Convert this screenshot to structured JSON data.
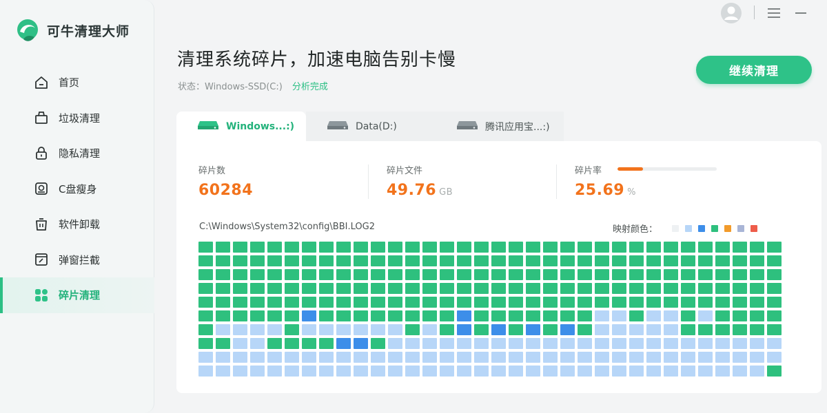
{
  "app": {
    "name": "可牛清理大师"
  },
  "sidebar": {
    "items": [
      {
        "label": "首页",
        "icon": "home-icon"
      },
      {
        "label": "垃圾清理",
        "icon": "trash-cart-icon"
      },
      {
        "label": "隐私清理",
        "icon": "lock-icon"
      },
      {
        "label": "C盘瘦身",
        "icon": "disk-icon"
      },
      {
        "label": "软件卸载",
        "icon": "uninstall-icon"
      },
      {
        "label": "弹窗拦截",
        "icon": "popup-block-icon"
      },
      {
        "label": "碎片清理",
        "icon": "fragment-grid-icon",
        "active": true
      }
    ]
  },
  "header": {
    "title": "清理系统碎片，加速电脑告别卡慢",
    "status_prefix": "状态：Windows-SSD(C:)",
    "status_value": "分析完成",
    "continue_label": "继续清理"
  },
  "window_controls": {
    "avatar": "user-avatar-icon",
    "menu": "menu-icon",
    "minimize": "minimize-icon"
  },
  "tabs": [
    {
      "label": "Windows...:)",
      "active": true
    },
    {
      "label": "Data(D:)",
      "active": false
    },
    {
      "label": "腾讯应用宝...:)",
      "active": false
    }
  ],
  "stats": {
    "fragments": {
      "label": "碎片数",
      "value": "60284"
    },
    "files": {
      "label": "碎片文件",
      "value": "49.76",
      "unit": "GB"
    },
    "rate": {
      "label": "碎片率",
      "value": "25.69",
      "unit": "%",
      "fraction": 0.2569
    }
  },
  "current_path": "C:\\Windows\\System32\\config\\BBI.LOG2",
  "legend": {
    "label": "映射颜色：",
    "colors": [
      "#eef1f3",
      "#b7d6f8",
      "#3d8ee9",
      "#2ec07e",
      "#f29b2b",
      "#a9b5d6",
      "#ee5d4b"
    ]
  },
  "colors": {
    "accent": "#2ec288",
    "orange": "#f2731c",
    "frag_green": "#2ec07e",
    "frag_light": "#b7d6f8",
    "frag_blue": "#3d8ee9"
  },
  "cluster_map": {
    "legend_key": "G = green(used), L = light blue(free), B = blue",
    "rows": [
      "GGGGGGGGGGGGGGGGGGGGGGGGGGGGGGGGGG",
      "GGGGGGGGGGGGGGGGGGGGGGGGGGGGGGGGGG",
      "GGGGGGGGGGGGGGGGGGGGGGGGGGGGGGGGGG",
      "GGGGGGGGGGGGGGGGGGGGGGGGGGGGGGGGGG",
      "GGGGGGGGGGGGGGGGGGGGGGGGGGGGGGGGGG",
      "GGGGGGBGGGGGGGGBGGGGGGGLLGLLGLGGGG",
      "GLLLLGLLLLLLGLGBGBGBGBGLLLLLGGGGGG",
      "GGLLGGGGBBGLLLLLLLLLLLLLLLLLLLLLLL",
      "LLLLLLLLLLLLLLLLLLLLLLLLLLLLLLLLLL",
      "LLLLLLLLLLLLLLLLLLLLLLLLLLLLLLLLLG"
    ]
  }
}
